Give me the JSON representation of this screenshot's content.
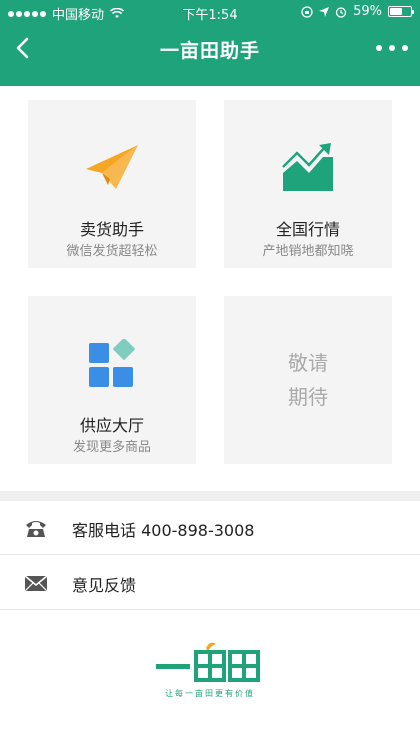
{
  "status": {
    "carrier": "中国移动",
    "time": "下午1:54",
    "battery_text": "59%",
    "battery_level": 0.59
  },
  "nav": {
    "title": "一亩田助手"
  },
  "cards": [
    {
      "label": "卖货助手",
      "sub": "微信发货超轻松",
      "icon": "paper-plane-icon"
    },
    {
      "label": "全国行情",
      "sub": "产地销地都知晓",
      "icon": "trend-chart-icon"
    },
    {
      "label": "供应大厅",
      "sub": "发现更多商品",
      "icon": "grid-tiles-icon"
    },
    {
      "label_line1": "敬请",
      "label_line2": "期待"
    }
  ],
  "rows": [
    {
      "label": "客服电话 400-898-3008",
      "icon": "phone-icon"
    },
    {
      "label": "意见反馈",
      "icon": "mail-icon"
    }
  ],
  "footer": {
    "slogan": "让每一亩田更有价值"
  },
  "colors": {
    "primary": "#1fa37a",
    "plane": "#f5a623",
    "tiles": "#3a8ee6"
  }
}
